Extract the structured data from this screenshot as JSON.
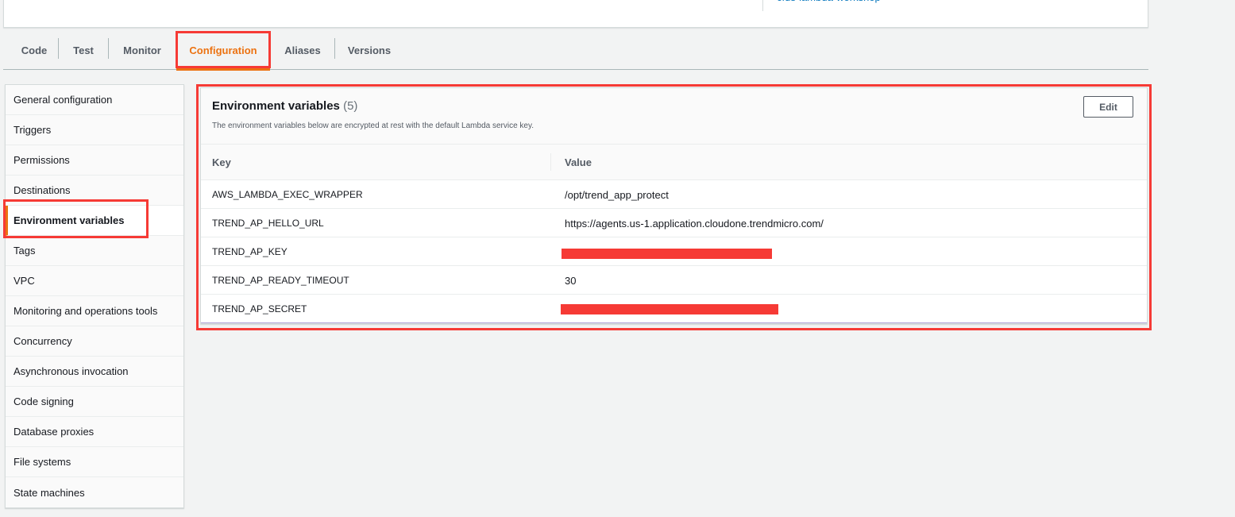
{
  "header": {
    "clipped_link_text": "cfus-lambda-workshop"
  },
  "tabs": [
    {
      "label": "Code",
      "active": false
    },
    {
      "label": "Test",
      "active": false
    },
    {
      "label": "Monitor",
      "active": false
    },
    {
      "label": "Configuration",
      "active": true
    },
    {
      "label": "Aliases",
      "active": false
    },
    {
      "label": "Versions",
      "active": false
    }
  ],
  "sidebar": {
    "items": [
      {
        "label": "General configuration",
        "active": false
      },
      {
        "label": "Triggers",
        "active": false
      },
      {
        "label": "Permissions",
        "active": false
      },
      {
        "label": "Destinations",
        "active": false
      },
      {
        "label": "Environment variables",
        "active": true
      },
      {
        "label": "Tags",
        "active": false
      },
      {
        "label": "VPC",
        "active": false
      },
      {
        "label": "Monitoring and operations tools",
        "active": false
      },
      {
        "label": "Concurrency",
        "active": false
      },
      {
        "label": "Asynchronous invocation",
        "active": false
      },
      {
        "label": "Code signing",
        "active": false
      },
      {
        "label": "Database proxies",
        "active": false
      },
      {
        "label": "File systems",
        "active": false
      },
      {
        "label": "State machines",
        "active": false
      }
    ]
  },
  "env_panel": {
    "title": "Environment variables",
    "count": "(5)",
    "description": "The environment variables below are encrypted at rest with the default Lambda service key.",
    "edit_label": "Edit",
    "columns": {
      "key": "Key",
      "value": "Value"
    },
    "rows": [
      {
        "key": "AWS_LAMBDA_EXEC_WRAPPER",
        "value": "/opt/trend_app_protect",
        "redacted": false
      },
      {
        "key": "TREND_AP_HELLO_URL",
        "value": "https://agents.us-1.application.cloudone.trendmicro.com/",
        "redacted": false
      },
      {
        "key": "TREND_AP_KEY",
        "value": "",
        "redacted": true
      },
      {
        "key": "TREND_AP_READY_TIMEOUT",
        "value": "30",
        "redacted": false
      },
      {
        "key": "TREND_AP_SECRET",
        "value": "",
        "redacted": true
      }
    ]
  },
  "colors": {
    "accent": "#ec7211",
    "annotation_red": "#f63a35",
    "text": "#16191f",
    "muted": "#545b64",
    "background": "#f2f3f3"
  }
}
